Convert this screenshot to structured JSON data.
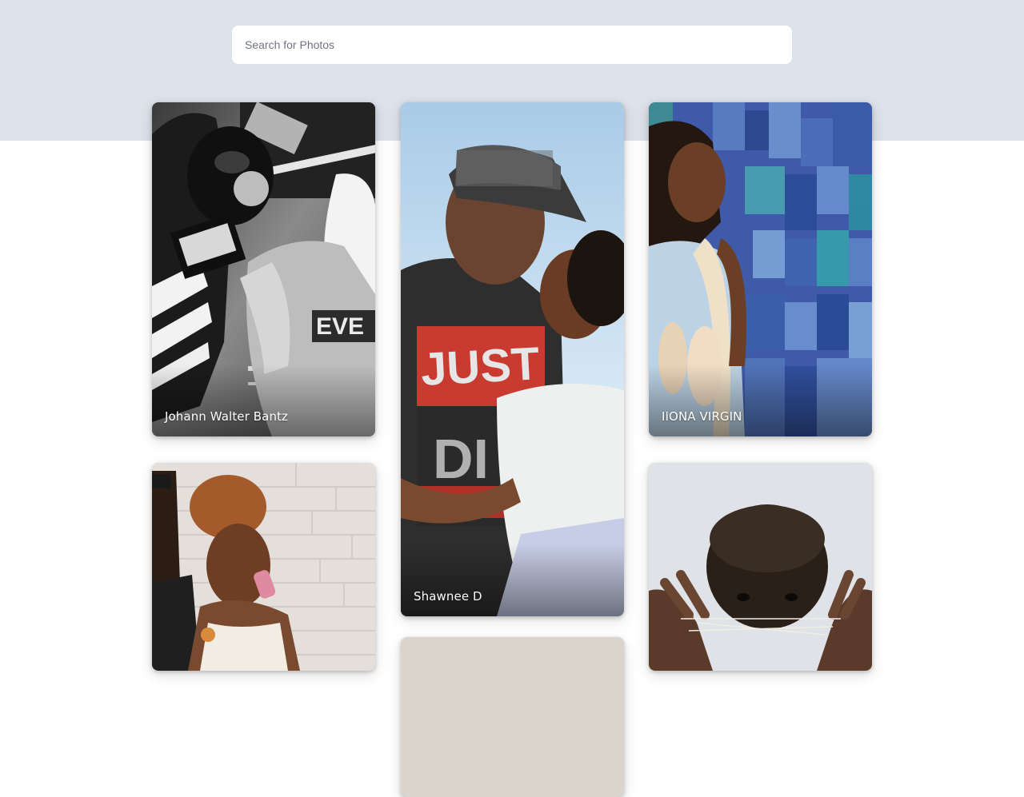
{
  "search": {
    "placeholder": "Search for Photos"
  },
  "gallery": {
    "photos": [
      {
        "author": "Johann Walter Bantz",
        "subject": "black-and-white boxing match"
      },
      {
        "author": "Shawnee D",
        "subject": "couple embracing outdoors"
      },
      {
        "author": "IIONA VIRGIN",
        "subject": "girl with ballet shoes by blue tiled wall"
      },
      {
        "author": "",
        "subject": "woman with curly hair by white brick wall"
      },
      {
        "author": "",
        "subject": "boy playing string game"
      },
      {
        "author": "",
        "subject": "partially visible photo"
      }
    ]
  },
  "colors": {
    "hero_band": "#dde1ea",
    "search_background": "#ffffff",
    "page_background": "#ffffff",
    "caption_text": "#ffffff"
  }
}
